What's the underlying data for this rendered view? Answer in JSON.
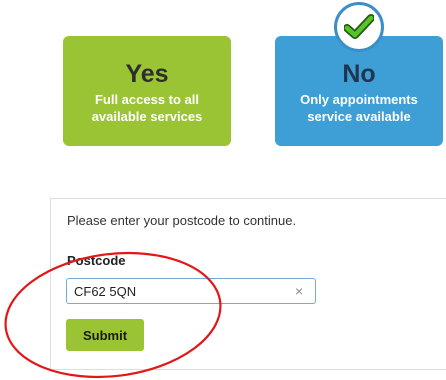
{
  "options": {
    "yes": {
      "title": "Yes",
      "line1": "Full access to all",
      "line2": "available services",
      "color": "#9bc434"
    },
    "no": {
      "title": "No",
      "line1": "Only appointments",
      "line2": "service available",
      "color": "#3d9fd6",
      "selected": true
    }
  },
  "selection_icon": "checkmark-icon",
  "form": {
    "intro": "Please enter your postcode to continue.",
    "label": "Postcode",
    "value": "CF62 5QN",
    "clear_icon": "×",
    "submit_label": "Submit"
  },
  "annotation": {
    "shape": "red-ellipse",
    "color": "#e01818"
  }
}
